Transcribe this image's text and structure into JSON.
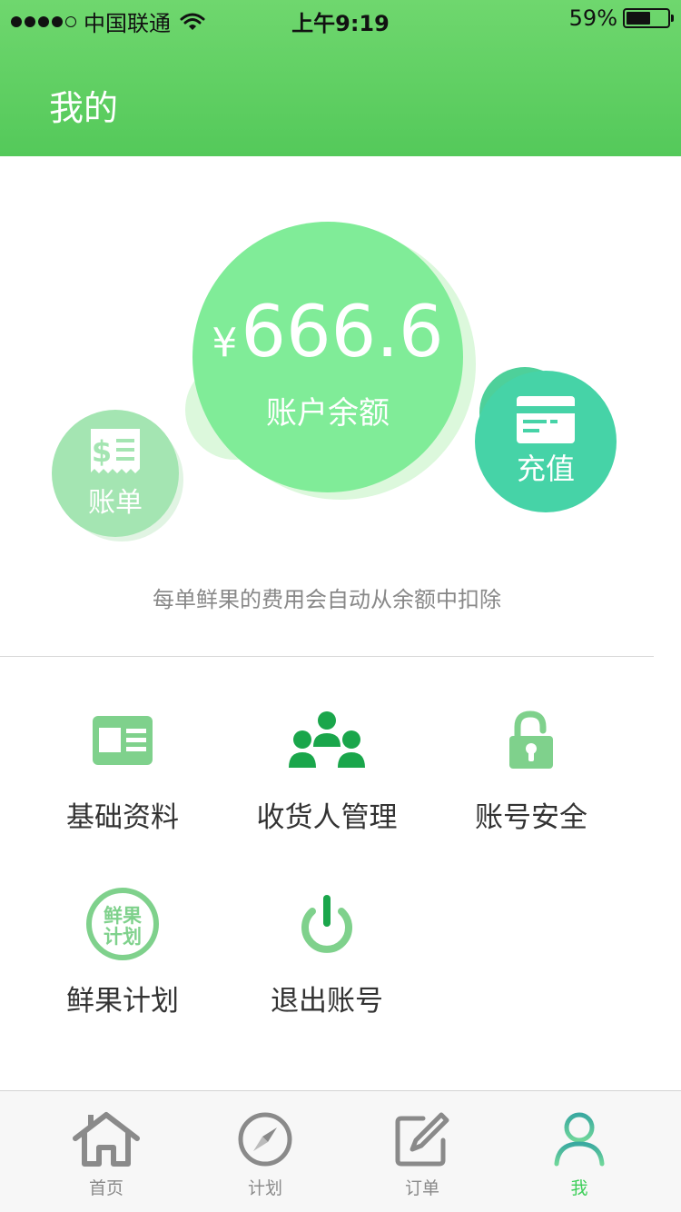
{
  "status_bar": {
    "carrier": "中国联通",
    "time": "上午9:19",
    "battery_percent": "59%",
    "battery_level": 0.59,
    "signal_bars_filled": 4,
    "signal_bars_total": 5
  },
  "header": {
    "title": "我的",
    "color": "#5fd062"
  },
  "balance": {
    "currency": "¥",
    "amount": "666.6",
    "label": "账户余额"
  },
  "actions": {
    "bill_label": "账单",
    "recharge_label": "充值"
  },
  "hint": "每单鲜果的费用会自动从余额中扣除",
  "menu": {
    "profile": "基础资料",
    "receivers": "收货人管理",
    "security": "账号安全",
    "plan": "鲜果计划",
    "plan_badge_line1": "鲜果",
    "plan_badge_line2": "计划",
    "logout": "退出账号"
  },
  "tabs": {
    "home": "首页",
    "plan": "计划",
    "orders": "订单",
    "me": "我",
    "active": "me",
    "active_color": "#3ecf5a"
  },
  "icons": [
    "wifi-icon",
    "battery-icon",
    "receipt-icon",
    "card-icon",
    "id-card-icon",
    "people-icon",
    "unlock-icon",
    "plan-badge-icon",
    "power-icon",
    "home-icon",
    "compass-icon",
    "edit-icon",
    "user-icon"
  ]
}
